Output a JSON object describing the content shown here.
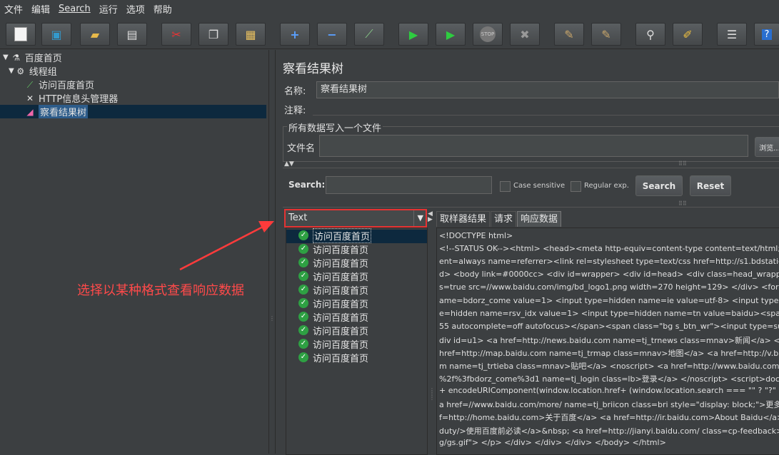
{
  "menu": [
    "文件",
    "编辑",
    "Search",
    "运行",
    "选项",
    "帮助"
  ],
  "toolbar": {
    "icons": [
      "new-icon",
      "templates-icon",
      "open-icon",
      "save-icon",
      "cut-icon",
      "copy-icon",
      "paste-icon",
      "expand-icon",
      "collapse-icon",
      "toggle-icon",
      "start-icon",
      "start-no-pause-icon",
      "stop-icon",
      "shutdown-icon",
      "clear-icon",
      "clear-all-icon",
      "search-icon",
      "reset-search-icon",
      "function-helper-icon",
      "help-icon"
    ],
    "stop_label": "STOP"
  },
  "tree": {
    "items": [
      {
        "label": "百度首页",
        "icon": "flask-icon",
        "expander": "▼"
      },
      {
        "label": "线程组",
        "icon": "gear-icon",
        "expander": "▼"
      },
      {
        "label": "访问百度首页",
        "icon": "pipette-icon"
      },
      {
        "label": "HTTP信息头管理器",
        "icon": "wrench-icon"
      },
      {
        "label": "察看结果树",
        "icon": "chart-icon"
      }
    ]
  },
  "panel": {
    "title": "察看结果树",
    "name_label": "名称:",
    "name_value": "察看结果树",
    "comment_label": "注释:",
    "comment_value": "",
    "group_title": "所有数据写入一个文件",
    "file_label": "文件名",
    "file_value": "",
    "browse_label": "浏览..."
  },
  "search": {
    "label": "Search:",
    "value": "",
    "case_sensitive": "Case sensitive",
    "regular_exp": "Regular exp.",
    "search_button": "Search",
    "reset_button": "Reset"
  },
  "renderer": {
    "selected": "Text"
  },
  "results": [
    "访问百度首页",
    "访问百度首页",
    "访问百度首页",
    "访问百度首页",
    "访问百度首页",
    "访问百度首页",
    "访问百度首页",
    "访问百度首页",
    "访问百度首页",
    "访问百度首页"
  ],
  "tabs": [
    "取样器结果",
    "请求",
    "响应数据"
  ],
  "response_lines": [
    "<!DOCTYPE html>",
    "<!--STATUS OK--><html> <head><meta http-equiv=content-type content=text/html;charse",
    "ent=always name=referrer><link rel=stylesheet type=text/css href=http://s1.bdstatic.com",
    "d> <body link=#0000cc> <div id=wrapper> <div id=head> <div class=head_wrapper> <d",
    "s=true src=//www.baidu.com/img/bd_logo1.png width=270 height=129> </div> <form id=",
    "ame=bdorz_come value=1> <input type=hidden name=ie value=utf-8> <input type=hidde",
    "e=hidden name=rsv_idx value=1> <input type=hidden name=tn value=baidu><span clas",
    "55 autocomplete=off autofocus></span><span class=\"bg s_btn_wr\"><input type=subm",
    "div id=u1> <a href=http://news.baidu.com name=tj_trnews class=mnav>新闻</a> <a hre",
    " href=http://map.baidu.com name=tj_trmap class=mnav>地图</a> <a href=http://v.baidu.",
    "m name=tj_trtieba class=mnav>贴吧</a> <noscript> <a href=http://www.baidu.com/bdor",
    "%2f%3fbdorz_come%3d1 name=tj_login class=lb>登录</a> </noscript> <script>docum",
    "+ encodeURIComponent(window.location.href+ (window.location.search === \"\" ? \"?\" : \"&",
    "a href=//www.baidu.com/more/ name=tj_briicon class=bri style=\"display: block;\">更多产",
    "f=http://home.baidu.com>关于百度</a> <a href=http://ir.baidu.com>About Baidu</a> </p>",
    "duty/>使用百度前必读</a>&nbsp; <a href=http://jianyi.baidu.com/ class=cp-feedback>意见",
    "g/gs.gif\"> </p> </div> </div> </div> </body> </html>"
  ],
  "annotation": "选择以某种格式查看响应数据",
  "colors": {
    "annotation": "#ff3b3b",
    "selection": "#0d293e",
    "success": "#2ea043"
  }
}
